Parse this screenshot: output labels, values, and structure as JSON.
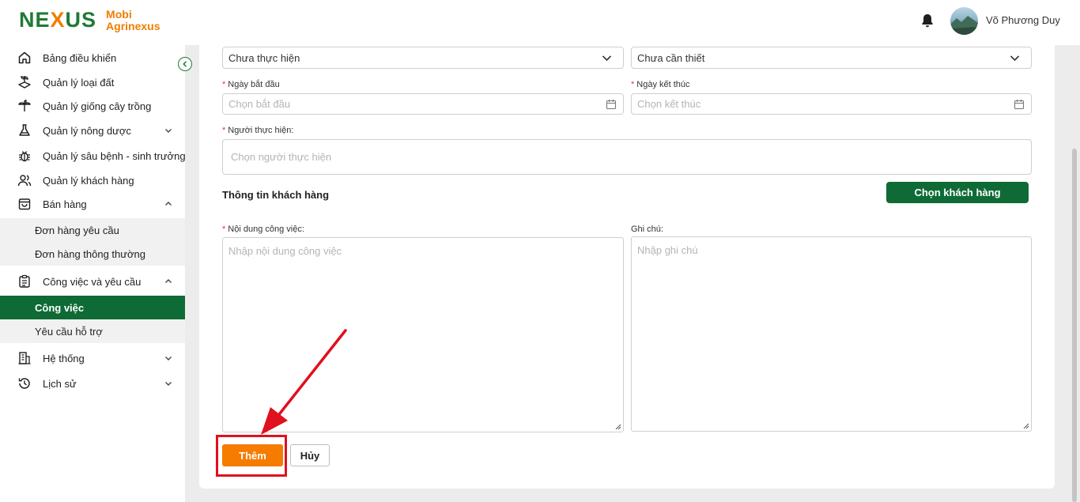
{
  "header": {
    "logo_mark_left": "NE",
    "logo_mark_x": "X",
    "logo_mark_right": "US",
    "logo_line1": "Mobi",
    "logo_line2": "Agrinexus",
    "username": "Võ Phương Duy"
  },
  "sidebar": {
    "items": [
      {
        "label": "Bảng điều khiển",
        "icon": "home-icon"
      },
      {
        "label": "Quản lý loại đất",
        "icon": "soil-icon"
      },
      {
        "label": "Quản lý giống cây trồng",
        "icon": "plant-icon"
      },
      {
        "label": "Quản lý nông dược",
        "icon": "flask-icon"
      },
      {
        "label": "Quản lý sâu bệnh - sinh trưởng",
        "icon": "bug-icon"
      },
      {
        "label": "Quản lý khách hàng",
        "icon": "users-icon"
      },
      {
        "label": "Bán hàng",
        "icon": "shopping-bag-icon"
      },
      {
        "label": "Công việc và yêu cầu",
        "icon": "clipboard-icon"
      },
      {
        "label": "Hệ thống",
        "icon": "building-icon"
      },
      {
        "label": "Lịch sử",
        "icon": "history-icon"
      }
    ],
    "sales_sub": [
      "Đơn hàng yêu cầu",
      "Đơn hàng thông thường"
    ],
    "work_sub": [
      "Công việc",
      "Yêu cầu hỗ trợ"
    ]
  },
  "form": {
    "status_value": "Chưa thực hiện",
    "priority_value": "Chưa cần thiết",
    "start_label": "Ngày bắt đầu",
    "start_placeholder": "Chọn bắt đầu",
    "end_label": "Ngày kết thúc",
    "end_placeholder": "Chọn kết thúc",
    "assignee_label": "Người thực hiện:",
    "assignee_placeholder": "Chọn người thực hiện",
    "customer_section": "Thông tin khách hàng",
    "choose_customer_button": "Chọn khách hàng",
    "content_label": "Nội dung công việc:",
    "content_placeholder": "Nhập nội dung công việc",
    "note_label": "Ghi chú:",
    "note_placeholder": "Nhập ghi chú",
    "required_mark": "*",
    "add_button": "Thêm",
    "cancel_button": "Hủy"
  },
  "colors": {
    "brand_green": "#0f6b35",
    "accent_orange": "#f57c00",
    "annotation_red": "#e0101e"
  }
}
